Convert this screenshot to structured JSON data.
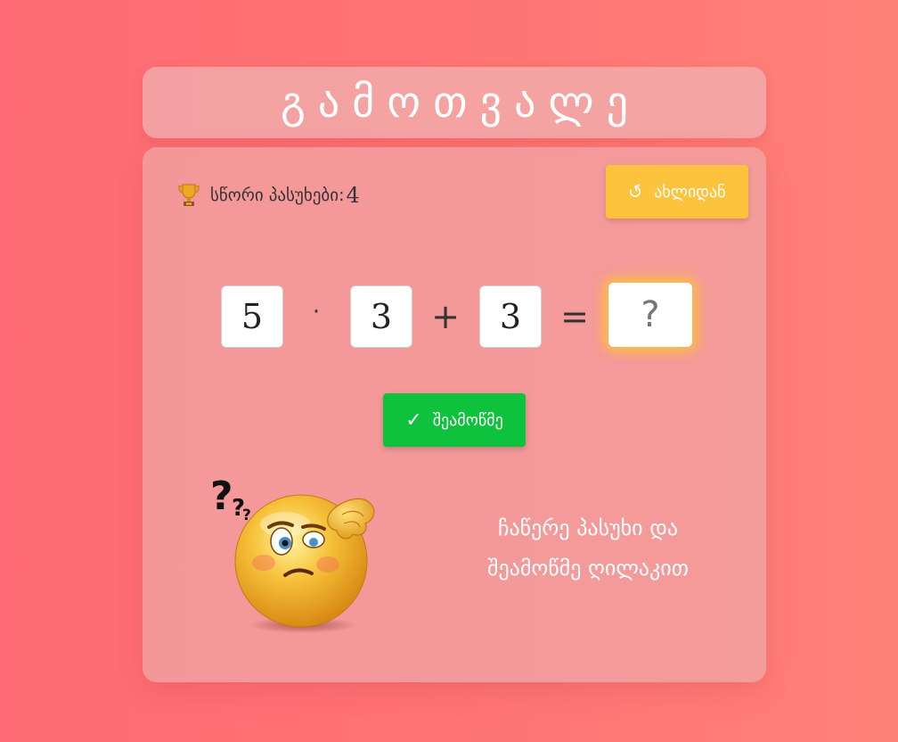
{
  "header": {
    "title": "გამოთვალე"
  },
  "score": {
    "icon": "trophy-icon",
    "label": "სწორი პასუხები:",
    "value": "4"
  },
  "restart_button": {
    "icon": "restart-icon",
    "label": "ახლიდან"
  },
  "equation": {
    "operand1": "5",
    "operator1": "·",
    "operand2": "3",
    "operator2": "+",
    "operand3": "3",
    "equals": "=",
    "answer_placeholder": "?"
  },
  "check_button": {
    "icon": "checkmark-icon",
    "label": "შეამოწმე"
  },
  "illustration": {
    "icon": "thinking-emoji-icon"
  },
  "hint": {
    "line1": "ჩაწერე პასუხი და",
    "line2": "შეამოწმე ღილაკით"
  },
  "colors": {
    "background": "#ff7475",
    "restart_button": "#fdc33c",
    "check_button": "#0ec23e",
    "answer_glow": "#ffc828"
  }
}
